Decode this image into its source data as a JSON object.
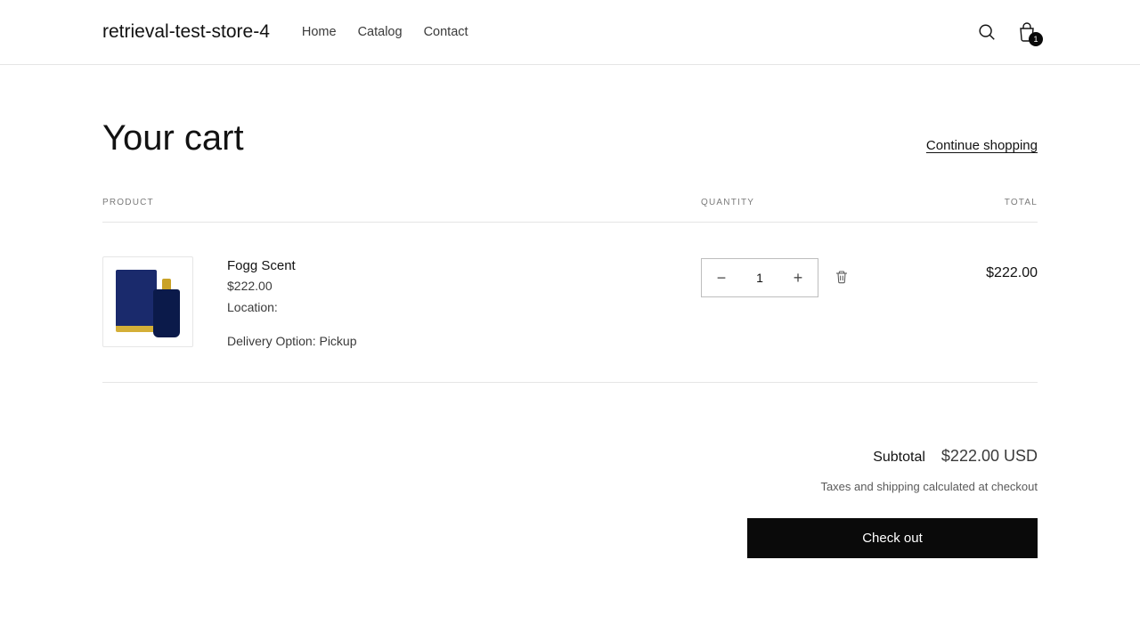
{
  "header": {
    "store_name": "retrieval-test-store-4",
    "nav": {
      "home": "Home",
      "catalog": "Catalog",
      "contact": "Contact"
    },
    "cart_count": "1"
  },
  "cart": {
    "title": "Your cart",
    "continue": "Continue shopping",
    "columns": {
      "product": "PRODUCT",
      "quantity": "QUANTITY",
      "total": "TOTAL"
    },
    "item": {
      "name": "Fogg Scent",
      "price": "$222.00",
      "location_label": "Location:",
      "delivery": "Delivery Option: Pickup",
      "qty": "1",
      "line_total": "$222.00"
    },
    "subtotal_label": "Subtotal",
    "subtotal_amount": "$222.00 USD",
    "tax_note": "Taxes and shipping calculated at checkout",
    "checkout": "Check out"
  }
}
